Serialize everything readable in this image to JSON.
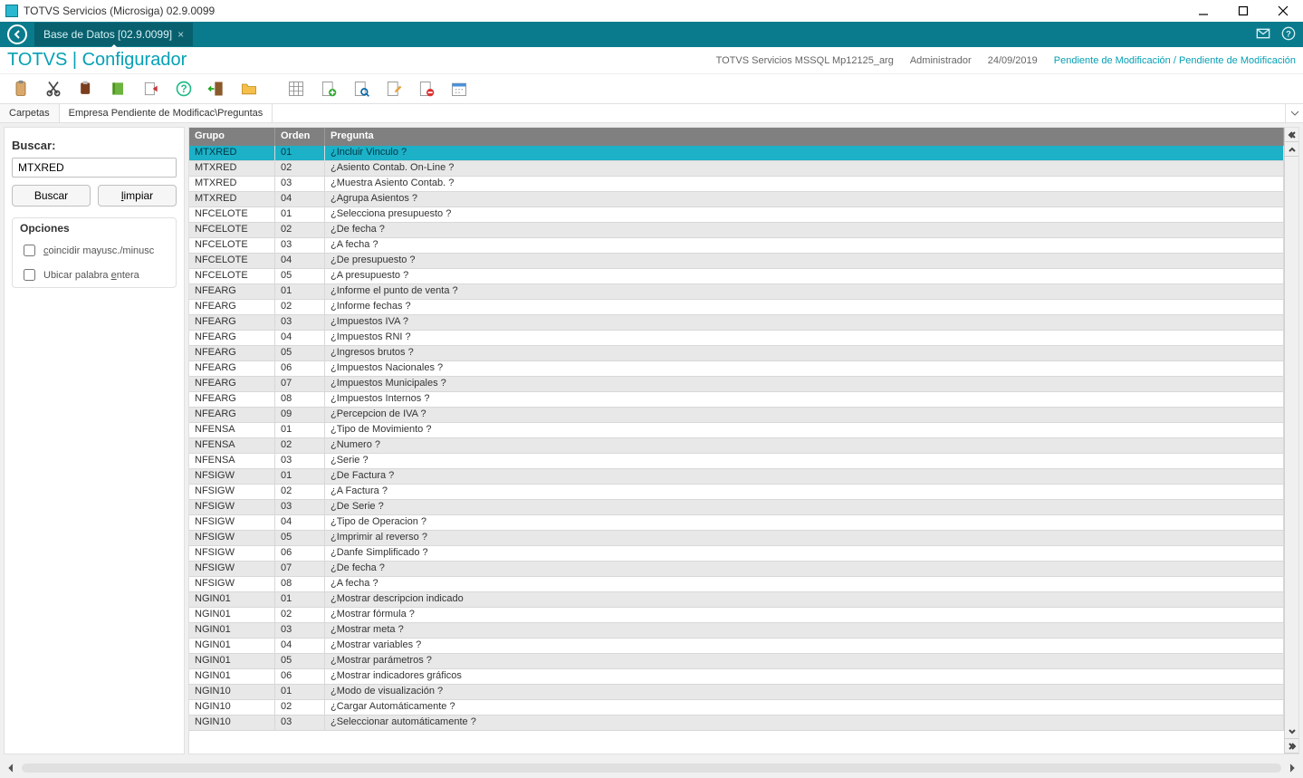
{
  "window": {
    "title": "TOTVS Servicios (Microsiga) 02.9.0099"
  },
  "tealbar": {
    "tab_label": "Base de Datos [02.9.0099]"
  },
  "apphdr": {
    "title": "TOTVS | Configurador",
    "server": "TOTVS Servicios MSSQL Mp12125_arg",
    "user": "Administrador",
    "date": "24/09/2019",
    "status": "Pendiente de Modificación / Pendiente de Modificación"
  },
  "crumb": {
    "tab1": "Carpetas",
    "tab2": "Empresa Pendiente de Modificac\\Preguntas"
  },
  "sidebar": {
    "search_label": "Buscar:",
    "search_value": "MTXRED",
    "btn_search": "Buscar",
    "btn_clear": "limpiar",
    "opts_title": "Opciones",
    "chk1": "coincidir mayusc./minusc",
    "chk2": "Ubicar palabra entera"
  },
  "grid": {
    "headers": {
      "grupo": "Grupo",
      "orden": "Orden",
      "pregunta": "Pregunta"
    },
    "rows": [
      {
        "g": "MTXRED",
        "o": "01",
        "p": "¿Incluir Vinculo ?",
        "sel": true
      },
      {
        "g": "MTXRED",
        "o": "02",
        "p": "¿Asiento Contab. On-Line ?"
      },
      {
        "g": "MTXRED",
        "o": "03",
        "p": "¿Muestra Asiento Contab. ?"
      },
      {
        "g": "MTXRED",
        "o": "04",
        "p": "¿Agrupa Asientos ?"
      },
      {
        "g": "NFCELOTE",
        "o": "01",
        "p": "¿Selecciona presupuesto ?"
      },
      {
        "g": "NFCELOTE",
        "o": "02",
        "p": "¿De fecha ?"
      },
      {
        "g": "NFCELOTE",
        "o": "03",
        "p": "¿A fecha ?"
      },
      {
        "g": "NFCELOTE",
        "o": "04",
        "p": "¿De presupuesto ?"
      },
      {
        "g": "NFCELOTE",
        "o": "05",
        "p": "¿A presupuesto ?"
      },
      {
        "g": "NFEARG",
        "o": "01",
        "p": "¿Informe el punto de venta ?"
      },
      {
        "g": "NFEARG",
        "o": "02",
        "p": "¿Informe fechas ?"
      },
      {
        "g": "NFEARG",
        "o": "03",
        "p": "¿Impuestos IVA ?"
      },
      {
        "g": "NFEARG",
        "o": "04",
        "p": "¿Impuestos RNI ?"
      },
      {
        "g": "NFEARG",
        "o": "05",
        "p": "¿Ingresos brutos ?"
      },
      {
        "g": "NFEARG",
        "o": "06",
        "p": "¿Impuestos Nacionales ?"
      },
      {
        "g": "NFEARG",
        "o": "07",
        "p": "¿Impuestos Municipales ?"
      },
      {
        "g": "NFEARG",
        "o": "08",
        "p": "¿Impuestos Internos ?"
      },
      {
        "g": "NFEARG",
        "o": "09",
        "p": "¿Percepcion de IVA ?"
      },
      {
        "g": "NFENSA",
        "o": "01",
        "p": "¿Tipo de Movimiento ?"
      },
      {
        "g": "NFENSA",
        "o": "02",
        "p": "¿Numero ?"
      },
      {
        "g": "NFENSA",
        "o": "03",
        "p": "¿Serie ?"
      },
      {
        "g": "NFSIGW",
        "o": "01",
        "p": "¿De Factura ?"
      },
      {
        "g": "NFSIGW",
        "o": "02",
        "p": "¿A Factura ?"
      },
      {
        "g": "NFSIGW",
        "o": "03",
        "p": "¿De Serie ?"
      },
      {
        "g": "NFSIGW",
        "o": "04",
        "p": "¿Tipo de Operacion ?"
      },
      {
        "g": "NFSIGW",
        "o": "05",
        "p": "¿Imprimir al reverso ?"
      },
      {
        "g": "NFSIGW",
        "o": "06",
        "p": "¿Danfe Simplificado ?"
      },
      {
        "g": "NFSIGW",
        "o": "07",
        "p": "¿De fecha ?"
      },
      {
        "g": "NFSIGW",
        "o": "08",
        "p": "¿A fecha ?"
      },
      {
        "g": "NGIN01",
        "o": "01",
        "p": "¿Mostrar descripcion indicado"
      },
      {
        "g": "NGIN01",
        "o": "02",
        "p": "¿Mostrar fórmula ?"
      },
      {
        "g": "NGIN01",
        "o": "03",
        "p": "¿Mostrar meta ?"
      },
      {
        "g": "NGIN01",
        "o": "04",
        "p": "¿Mostrar variables ?"
      },
      {
        "g": "NGIN01",
        "o": "05",
        "p": "¿Mostrar parámetros ?"
      },
      {
        "g": "NGIN01",
        "o": "06",
        "p": "¿Mostrar indicadores gráficos"
      },
      {
        "g": "NGIN10",
        "o": "01",
        "p": "¿Modo de visualización ?"
      },
      {
        "g": "NGIN10",
        "o": "02",
        "p": "¿Cargar Automáticamente ?"
      },
      {
        "g": "NGIN10",
        "o": "03",
        "p": "¿Seleccionar automáticamente ?"
      }
    ]
  }
}
